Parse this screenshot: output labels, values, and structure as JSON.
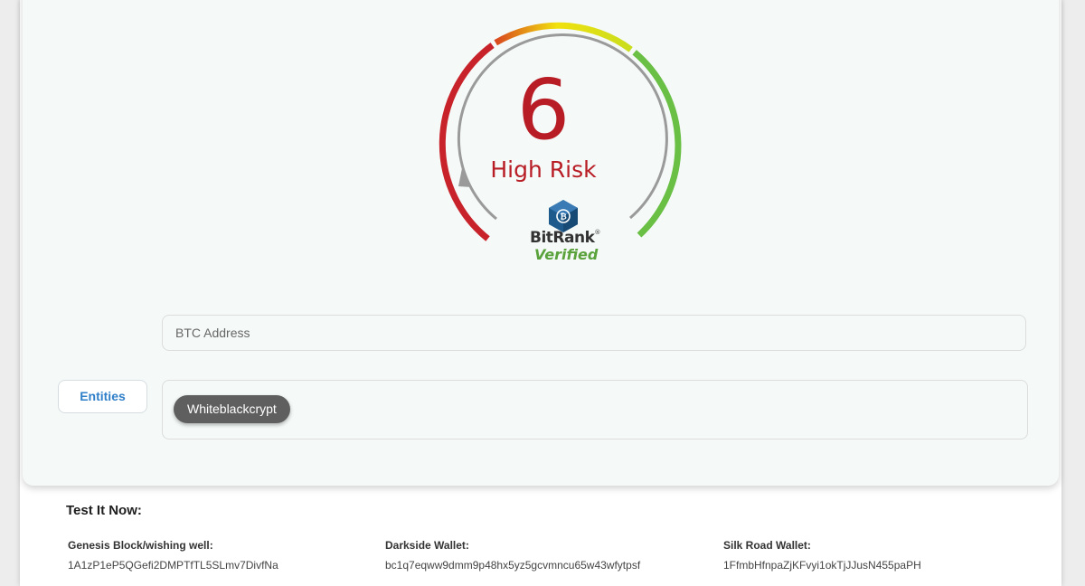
{
  "gauge": {
    "score": "6",
    "risk_label": "High Risk",
    "brand": "BitRank",
    "brand_mark": "®",
    "verified": "Verified",
    "colors": {
      "red": "#c8232b",
      "orange": "#e2731c",
      "yellow": "#f1e10d",
      "green": "#6abf45",
      "needle": "#9a9a9a",
      "score_text": "#b81c24",
      "badge": "#1e5a8c"
    },
    "icons": [
      "bitrank-cube-icon",
      "needle-pointer-icon"
    ]
  },
  "address_input": {
    "placeholder": "BTC Address",
    "value": ""
  },
  "entities": {
    "button_label": "Entities",
    "tags": [
      "Whiteblackcrypt"
    ]
  },
  "test_section": {
    "title": "Test It Now:",
    "wallets": [
      {
        "label": "Genesis Block/wishing well:",
        "address": "1A1zP1eP5QGefi2DMPTfTL5SLmv7DivfNa"
      },
      {
        "label": "Darkside Wallet:",
        "address": "bc1q7eqww9dmm9p48hx5yz5gcvmncu65w43wfytpsf"
      },
      {
        "label": "Silk Road Wallet:",
        "address": "1FfmbHfnpaZjKFvyi1okTjJJusN455paPH"
      }
    ]
  }
}
